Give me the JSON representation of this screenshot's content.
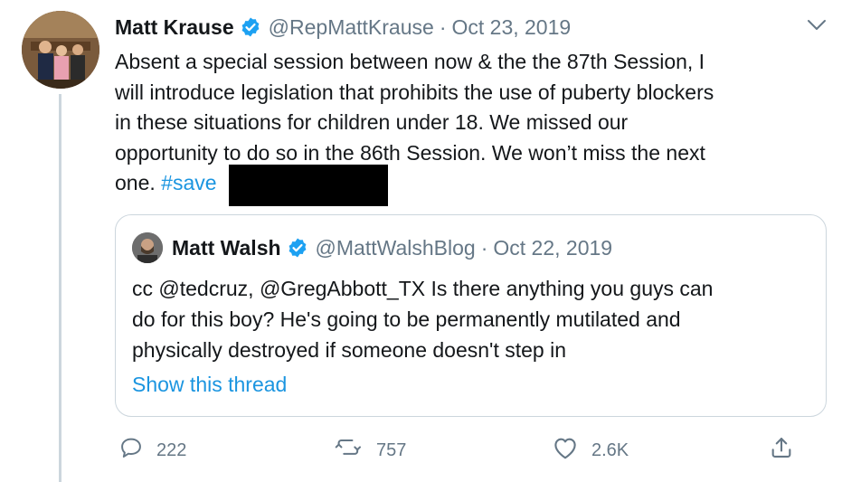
{
  "tweet": {
    "author_name": "Matt Krause",
    "author_handle": "@RepMattKrause",
    "separator": "·",
    "date": "Oct 23, 2019",
    "text_line1": "Absent a special session between now & the the 87th Session, I",
    "text_line2": "will introduce legislation that prohibits the use of puberty blockers",
    "text_line3": "in these situations  for children  under  18. We missed our",
    "text_line4": "opportunity to do so in the 86th Session. We won’t miss the next",
    "text_line5": "one.",
    "hashtag_visible": "#save",
    "verified_icon": "verified-badge-icon",
    "menu_icon": "chevron-down-icon"
  },
  "quoted": {
    "author_name": "Matt Walsh",
    "author_handle": "@MattWalshBlog",
    "separator": "·",
    "date": "Oct 22, 2019",
    "text_line1": "cc @tedcruz, @GregAbbott_TX   Is there anything you guys can",
    "text_line2": "do for this boy? He's going to be permanently mutilated and",
    "text_line3": "physically destroyed if someone doesn't step in",
    "show_thread": "Show this thread"
  },
  "actions": {
    "replies": "222",
    "retweets": "757",
    "likes": "2.6K",
    "reply_icon": "reply-icon",
    "retweet_icon": "retweet-icon",
    "like_icon": "heart-icon",
    "share_icon": "share-icon"
  },
  "colors": {
    "link": "#1b95e0",
    "muted": "#657786",
    "border": "#ccd6dd",
    "verified": "#1da1f2"
  }
}
